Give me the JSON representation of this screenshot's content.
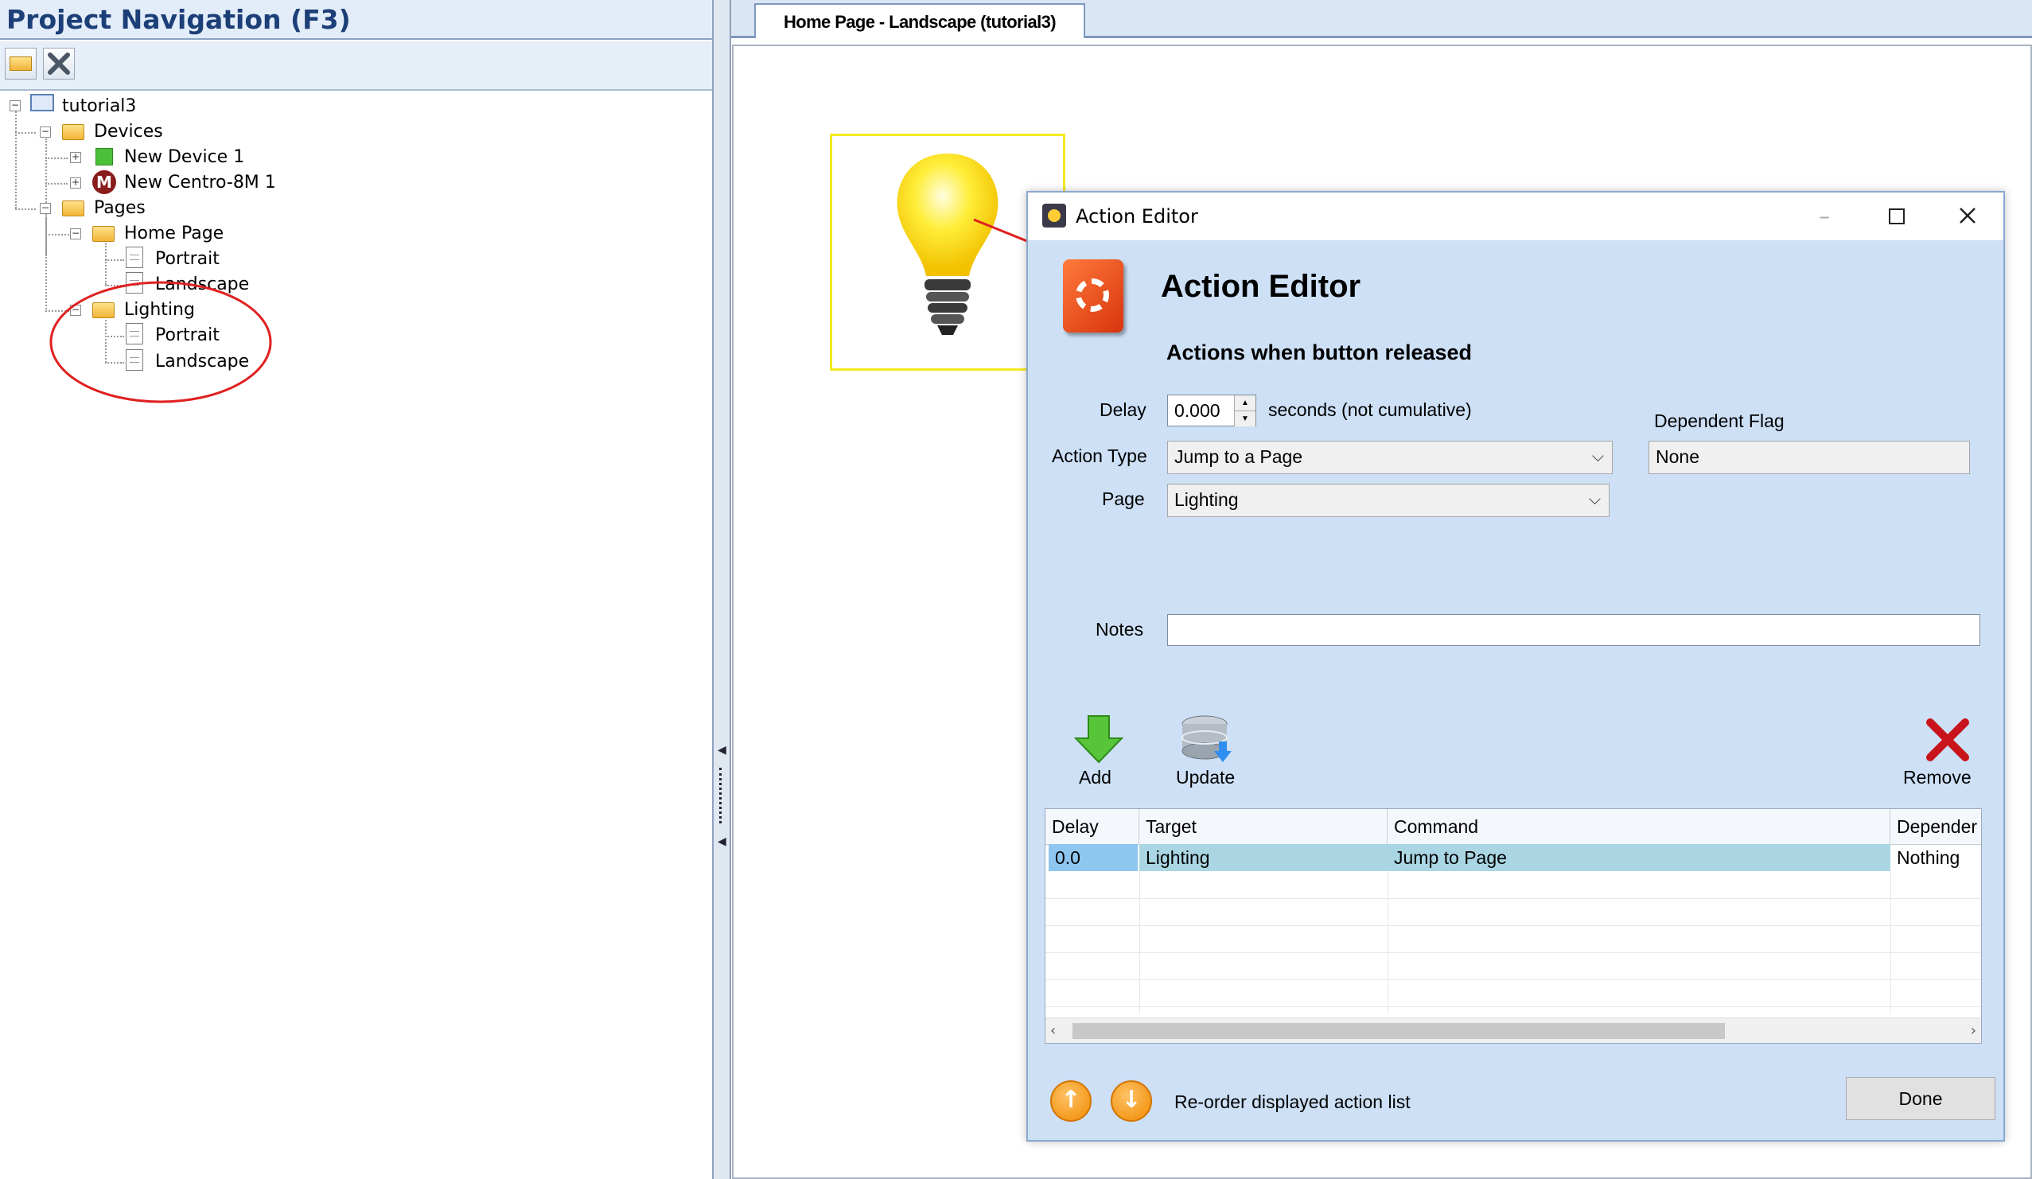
{
  "navigation": {
    "title": "Project Navigation (F3)",
    "tree": {
      "project": "tutorial3",
      "devices_folder": "Devices",
      "device1": "New Device 1",
      "device2": "New Centro-8M 1",
      "device2_badge": "M",
      "pages_folder": "Pages",
      "home_page": "Home Page",
      "home_portrait": "Portrait",
      "home_landscape": "Landscape",
      "lighting_page": "Lighting",
      "lighting_portrait": "Portrait",
      "lighting_landscape": "Landscape"
    }
  },
  "document": {
    "tab_label": "Home Page - Landscape (tutorial3)"
  },
  "dialog": {
    "window_title": "Action Editor",
    "heading": "Action Editor",
    "subheading": "Actions when button released",
    "delay_label": "Delay",
    "delay_value": "0.000",
    "delay_hint": "seconds (not cumulative)",
    "dependent_flag_label": "Dependent Flag",
    "dependent_flag_value": "None",
    "action_type_label": "Action Type",
    "action_type_value": "Jump to a Page",
    "page_label": "Page",
    "page_value": "Lighting",
    "notes_label": "Notes",
    "notes_value": "",
    "add_label": "Add",
    "update_label": "Update",
    "remove_label": "Remove",
    "columns": [
      "Delay",
      "Target",
      "Command",
      "Depender"
    ],
    "rows": [
      {
        "delay": "0.0",
        "target": "Lighting",
        "command": "Jump to Page",
        "dependent": "Nothing"
      }
    ],
    "reorder_label": "Re-order displayed action list",
    "done_label": "Done"
  },
  "colors": {
    "dialog_bg": "#cde0f6",
    "selected_row": "#aad6e4",
    "accent_orange": "#f08a00",
    "annotation_red": "#e02020"
  }
}
